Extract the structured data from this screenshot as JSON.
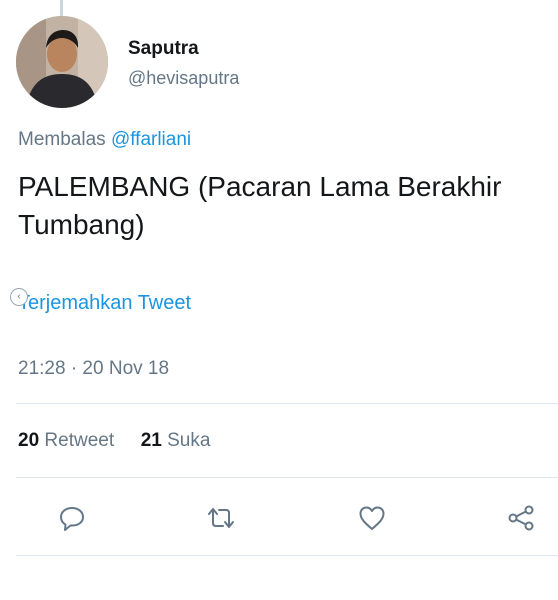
{
  "tweet": {
    "author_name": "Saputra",
    "author_handle": "@hevisaputra",
    "reply_prefix": "Membalas",
    "reply_to": "@ffarliani",
    "text": "PALEMBANG (Pacaran Lama Berakhir Tumbang)",
    "translate_label": "Terjemahkan Tweet",
    "timestamp": "21:28 · 20 Nov 18",
    "retweets_count": "20",
    "retweets_label": "Retweet",
    "likes_count": "21",
    "likes_label": "Suka"
  },
  "actions": {
    "reply_icon": "reply-icon",
    "retweet_icon": "retweet-icon",
    "like_icon": "heart-icon",
    "share_icon": "share-icon"
  },
  "colors": {
    "link": "#1b95e0",
    "secondary_text": "#657786",
    "primary_text": "#14171a",
    "divider": "#e1e8ed"
  }
}
